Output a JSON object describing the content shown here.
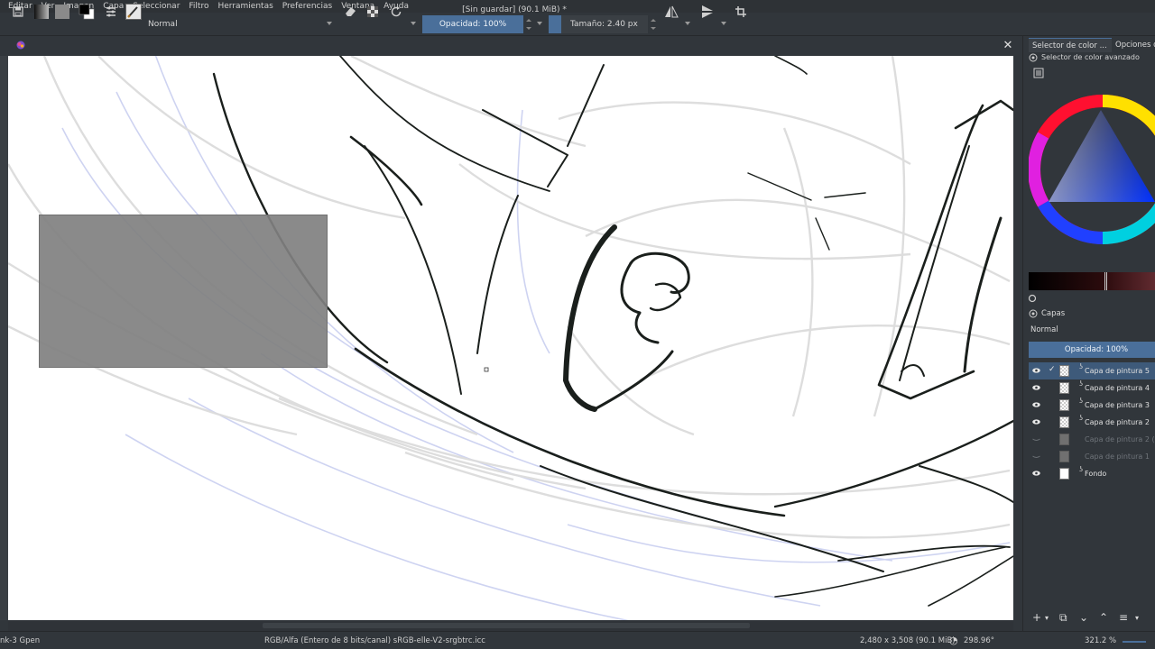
{
  "menu": [
    "Editar",
    "Ver",
    "Imagen",
    "Capa",
    "Seleccionar",
    "Filtro",
    "Herramientas",
    "Preferencias",
    "Ventana",
    "Ayuda"
  ],
  "toolbar": {
    "blend_mode": "Normal",
    "opacity": "Opacidad: 100%",
    "size": "Tamaño: 2.40 px"
  },
  "document": {
    "title": "[Sin guardar]  (90.1 MiB) *",
    "close_glyph": "✕"
  },
  "docker": {
    "tab_color": "Selector de color ...",
    "tab_options": "Opciones de",
    "color_section": "Selector de color avanzado",
    "layers_title": "Capas",
    "layers_blend": "Normal",
    "layers_opacity": "Opacidad:  100%"
  },
  "layers": [
    {
      "name": "Capa de pintura 5",
      "visible": true,
      "selected": true,
      "thumb": "checker",
      "dim": false
    },
    {
      "name": "Capa de pintura 4",
      "visible": true,
      "selected": false,
      "thumb": "checker",
      "dim": false
    },
    {
      "name": "Capa de pintura 3",
      "visible": true,
      "selected": false,
      "thumb": "checker",
      "dim": false
    },
    {
      "name": "Capa de pintura 2",
      "visible": true,
      "selected": false,
      "thumb": "checker",
      "dim": false
    },
    {
      "name": "Capa de pintura 2 (...",
      "visible": false,
      "selected": false,
      "thumb": "gray",
      "dim": true
    },
    {
      "name": "Capa de pintura 1",
      "visible": false,
      "selected": false,
      "thumb": "gray",
      "dim": true
    },
    {
      "name": "Fondo",
      "visible": true,
      "selected": false,
      "thumb": "solid",
      "dim": false
    }
  ],
  "status": {
    "brush": "nk-3 Gpen",
    "color_space": "RGB/Alfa (Entero de 8 bits/canal)  sRGB-elle-V2-srgbtrc.icc",
    "dimensions": "2,480 x 3,508 (90.1 MiB)",
    "rotation": "298.96°",
    "zoom": "321.2 %"
  },
  "colors": {
    "accent": "#4a6f9a",
    "ui_bg": "#31363b",
    "canvas": "#ffffff"
  }
}
